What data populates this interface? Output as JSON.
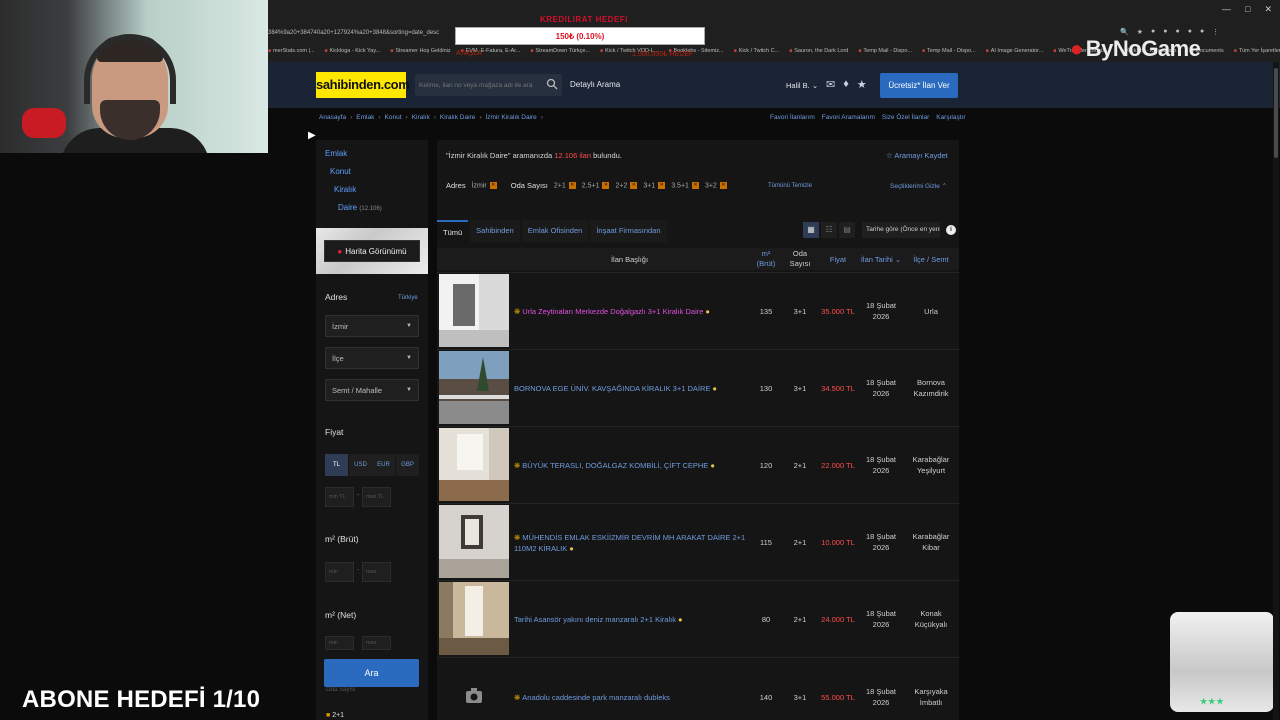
{
  "browser": {
    "url": "384%9a20+384740a20+127924%a20+3848&sorting=date_desc",
    "bookmarks": [
      "merStats.com |...",
      "Kickloga - Kick Yay...",
      "Streamer Hoş Geldiniz",
      "EVM. E-Fatura, E-Ar...",
      "StreamDown Türkçe...",
      "Kick / Twitch VOD-L...",
      "Booklabs - Sitemiz...",
      "Kick / Twitch C...",
      "Sauron, the Dark Lord",
      "Temp Mail - Dispo...",
      "Temp Mail - Dispo...",
      "AI Image Generator...",
      "WeTransfer | Büyük...",
      "KickBot - Kick Chatb...",
      "Documents",
      "Tüm Yer İşaretleri"
    ],
    "window_controls": [
      "—",
      "□",
      "✕"
    ],
    "toolbar_icons": [
      "🔍",
      "★",
      "●",
      "●",
      "●",
      "●",
      "●",
      "⋮"
    ]
  },
  "overlay": {
    "donate_title": "KREDILIRAT HEDEFi",
    "donate_progress": "150₺ (0.10%)",
    "donate_left": "ATAŞLA",
    "donate_right": "1.000.000₺ HEDEF",
    "sponsor": "ByNoGame",
    "subscriber_goal": "ABONE HEDEFİ 1/10",
    "cup_label": "★★★"
  },
  "header": {
    "logo": "sahibinden.com",
    "search_placeholder": "Kelime, ilan no veya mağaza adı ile ara",
    "detailed_search": "Detaylı Arama",
    "user": "Halil B. ⌄",
    "post_button": "Ücretsiz* İlan Ver"
  },
  "breadcrumb": [
    "Anasayfa",
    "Emlak",
    "Konut",
    "Kiralık",
    "Kiralık Daire",
    "İzmir Kiralık Daire"
  ],
  "top_links": [
    "Favori İlanlarım",
    "Favori Aramalarım",
    "Size Özel İlanlar",
    "Karşılaştır"
  ],
  "sidebar": {
    "categories": [
      "Emlak",
      "Konut",
      "Kiralık",
      "Daire"
    ],
    "daire_count": "(12.106)",
    "map_button": "Harita Görünümü",
    "address_label": "Adres",
    "country_link": "Türkiye",
    "city": "İzmir",
    "district": "İlçe",
    "neighborhood": "Semt / Mahalle",
    "price_label": "Fiyat",
    "currencies": [
      "TL",
      "USD",
      "EUR",
      "GBP"
    ],
    "price_min": "min TL",
    "price_max": "max TL",
    "m2_brut_label": "m² (Brüt)",
    "m2_net_label": "m² (Net)",
    "min": "min",
    "max": "max",
    "rooms_label": "Oda Sayısı",
    "room_option": "2+1",
    "search_button": "Ara"
  },
  "main": {
    "summary_query": "\"İzmir Kiralık Daire\"",
    "summary_mid": "aramanızda",
    "summary_count": "12.106 ilan",
    "summary_end": "bulundu.",
    "save_search": "☆ Aramayı Kaydet",
    "filter_address_label": "Adres",
    "filter_address": "İzmir",
    "filter_rooms_label": "Oda Sayısı",
    "filter_rooms": [
      "2+1",
      "2.5+1",
      "2+2",
      "3+1",
      "3.5+1",
      "3+2"
    ],
    "clear_all": "Tümünü Temizle",
    "hide_filters": "Seçtiklerimi Gizle ⌃",
    "tabs": [
      "Tümü",
      "Sahibinden",
      "Emlak Ofisinden",
      "İnşaat Firmasından"
    ],
    "sort": "Tarihe göre (Önce en yeni)",
    "columns": {
      "title": "İlan Başlığı",
      "m2": "m² (Brüt)",
      "rooms": "Oda Sayısı",
      "price": "Fiyat",
      "date": "İlan Tarihi ⌄",
      "location": "İlçe / Semt"
    },
    "listings": [
      {
        "title": "Urla Zeytinaları Merkezde Doğalgazlı 3+1 Kiralık Daire",
        "m2": "135",
        "rooms": "3+1",
        "price": "35.000 TL",
        "date_l1": "18 Şubat",
        "date_l2": "2026",
        "loc_l1": "Urla",
        "loc_l2": ""
      },
      {
        "title": "BORNOVA EGE ÜNİV. KAVŞAĞINDA KİRALIK 3+1 DAİRE",
        "m2": "130",
        "rooms": "3+1",
        "price": "34.500 TL",
        "date_l1": "18 Şubat",
        "date_l2": "2026",
        "loc_l1": "Bornova",
        "loc_l2": "Kazımdirik"
      },
      {
        "title": "BÜYÜK TERASLI, DOĞALGAZ KOMBİLİ, ÇİFT CEPHE",
        "m2": "120",
        "rooms": "2+1",
        "price": "22.000 TL",
        "date_l1": "18 Şubat",
        "date_l2": "2026",
        "loc_l1": "Karabağlar",
        "loc_l2": "Yeşilyurt"
      },
      {
        "title": "MÜHENDİS EMLAK ESKİİZMİR DEVRİM MH ARAKAT DAİRE 2+1 110M2 KİRALIK",
        "m2": "115",
        "rooms": "2+1",
        "price": "10.000 TL",
        "date_l1": "18 Şubat",
        "date_l2": "2026",
        "loc_l1": "Karabağlar",
        "loc_l2": "Kibar"
      },
      {
        "title": "Tarihi Asansör yakını deniz manzaralı 2+1 Kiralık",
        "m2": "80",
        "rooms": "2+1",
        "price": "24.000 TL",
        "date_l1": "18 Şubat",
        "date_l2": "2026",
        "loc_l1": "Konak",
        "loc_l2": "Küçükyalı"
      },
      {
        "title": "Anadolu caddesinde park manzaralı dubleks",
        "m2": "140",
        "rooms": "3+1",
        "price": "55.000 TL",
        "date_l1": "18 Şubat",
        "date_l2": "2026",
        "loc_l1": "Karşıyaka",
        "loc_l2": "İmbatlı"
      }
    ]
  }
}
